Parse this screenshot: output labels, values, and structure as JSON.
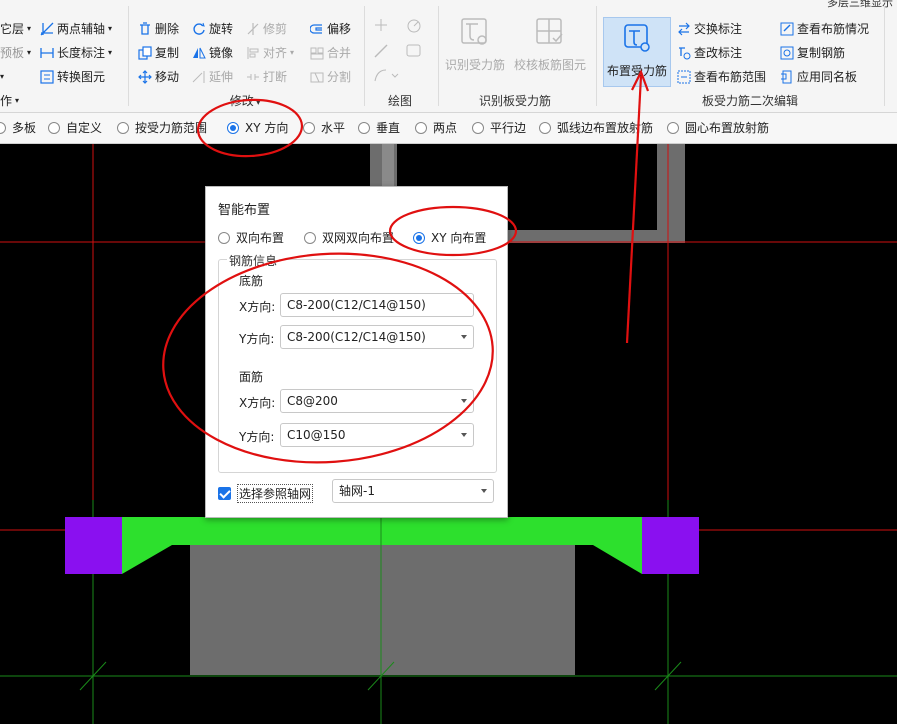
{
  "window_title": "多层三维显示",
  "ribbon": {
    "left_col": {
      "items": [
        "它层",
        "预板",
        "作"
      ]
    },
    "draw_col": {
      "two_point_axis": "两点辅轴",
      "length_dim": "长度标注",
      "convert_element": "转换图元"
    },
    "modify": {
      "delete": "删除",
      "rotate": "旋转",
      "trim": "修剪",
      "offset": "偏移",
      "copy": "复制",
      "mirror": "镜像",
      "align": "对齐",
      "merge": "合并",
      "move": "移动",
      "extend": "延伸",
      "break": "打断",
      "split": "分割",
      "group_label": "修改"
    },
    "draw_group_label": "绘图",
    "identify": {
      "identify_rebar": "识别受力筋",
      "check_rebar": "校核板筋图元",
      "group_label": "识别板受力筋"
    },
    "edit2": {
      "place_rebar": "布置受力筋",
      "swap_label": "交换标注",
      "change_label": "查改标注",
      "view_range": "查看布筋范围",
      "view_info": "查看布筋情况",
      "copy_rebar": "复制钢筋",
      "apply_same": "应用同名板",
      "group_label": "板受力筋二次编辑"
    }
  },
  "option_bar": {
    "options": [
      "多板",
      "自定义",
      "按受力筋范围",
      "XY 方向",
      "水平",
      "垂直",
      "两点",
      "平行边",
      "弧线边布置放射筋",
      "圆心布置放射筋"
    ],
    "selected": "XY 方向"
  },
  "dialog": {
    "title": "智能布置",
    "modes": [
      "双向布置",
      "双网双向布置",
      "XY 向布置"
    ],
    "selected_mode": "XY 向布置",
    "group_title": "钢筋信息",
    "bottom": {
      "heading": "底筋",
      "x_label": "X方向:",
      "x_value": "C8-200(C12/C14@150)",
      "y_label": "Y方向:",
      "y_value": "C8-200(C12/C14@150)"
    },
    "top": {
      "heading": "面筋",
      "x_label": "X方向:",
      "x_value": "C8@200",
      "y_label": "Y方向:",
      "y_value": "C10@150"
    },
    "ref_checkbox_label": "选择参照轴网",
    "ref_checked": true,
    "ref_value": "轴网-1"
  },
  "colors": {
    "accent": "#1a73e8",
    "annotation_red": "#e01010",
    "beam_green": "#2de02d",
    "column_purple": "#8a10f0",
    "grid_red": "#d01010",
    "grid_green": "#1a8a1a",
    "slab_gray": "#6d6d6d"
  }
}
